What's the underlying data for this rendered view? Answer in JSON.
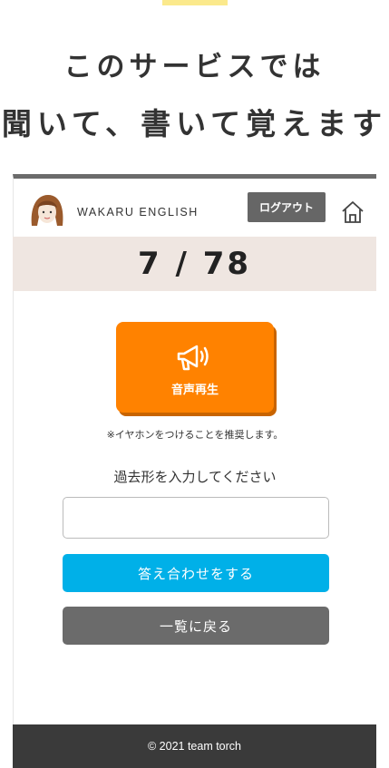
{
  "promo": {
    "line1": "このサービスでは",
    "line2": "聞いて、書いて覚えます"
  },
  "app": {
    "brand": "WAKARU ENGLISH",
    "logout_label": "ログアウト",
    "home_icon": "home-icon"
  },
  "progress": {
    "text": "7 / 78",
    "current": 7,
    "total": 78
  },
  "audio": {
    "label": "音声再生",
    "icon": "megaphone-icon"
  },
  "note": "※イヤホンをつけることを推奨します。",
  "prompt": "過去形を入力してください",
  "answer_input": {
    "value": "",
    "placeholder": ""
  },
  "buttons": {
    "check": "答え合わせをする",
    "back": "一覧に戻る"
  },
  "footer": "© 2021 team torch",
  "colors": {
    "orange": "#ff8200",
    "blue": "#00b0e8",
    "gray": "#6b6b6b",
    "band": "#efe6e1",
    "accent": "#fbe98c"
  }
}
